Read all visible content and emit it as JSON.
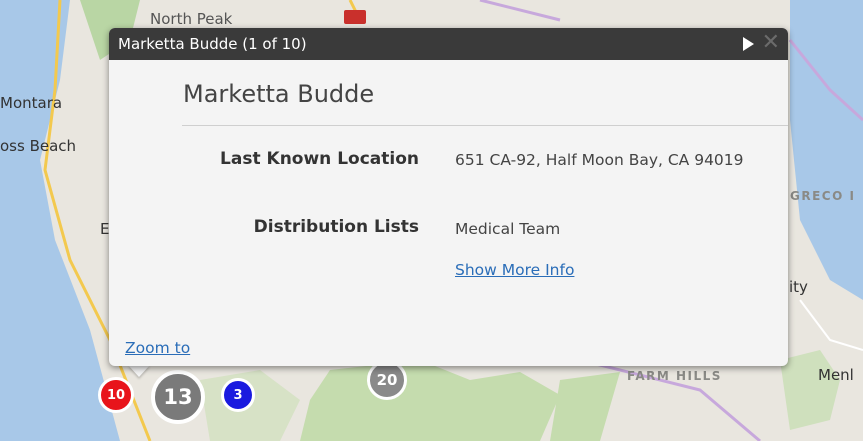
{
  "map": {
    "labels": {
      "north_peak": "North Peak",
      "montara": "Montara",
      "moss_beach": "oss Beach",
      "city": "ity",
      "greco": "GRECO I",
      "farm_hills": "FARM HILLS",
      "menlo": "Menl",
      "b_fragment": "E"
    },
    "clusters": [
      {
        "count": "10",
        "color": "#e8141b"
      },
      {
        "count": "13",
        "color": "#7a7a7a"
      },
      {
        "count": "3",
        "color": "#1a1adf"
      },
      {
        "count": "20",
        "color": "#8a8a8a"
      }
    ]
  },
  "popup": {
    "title": "Marketta Budde (1 of 10)",
    "next_icon": "play-right-icon",
    "close_icon": "close-x-icon",
    "name": "Marketta Budde",
    "fields": {
      "location_label": "Last Known Location",
      "location_value": "651 CA-92, Half Moon Bay, CA 94019",
      "distribution_label": "Distribution Lists",
      "distribution_value": "Medical Team"
    },
    "show_more": "Show More Info",
    "zoom_to": "Zoom to"
  },
  "colors": {
    "header_bg": "#3a3a3a",
    "link": "#2a6db8",
    "popup_bg": "#f4f4f4"
  }
}
